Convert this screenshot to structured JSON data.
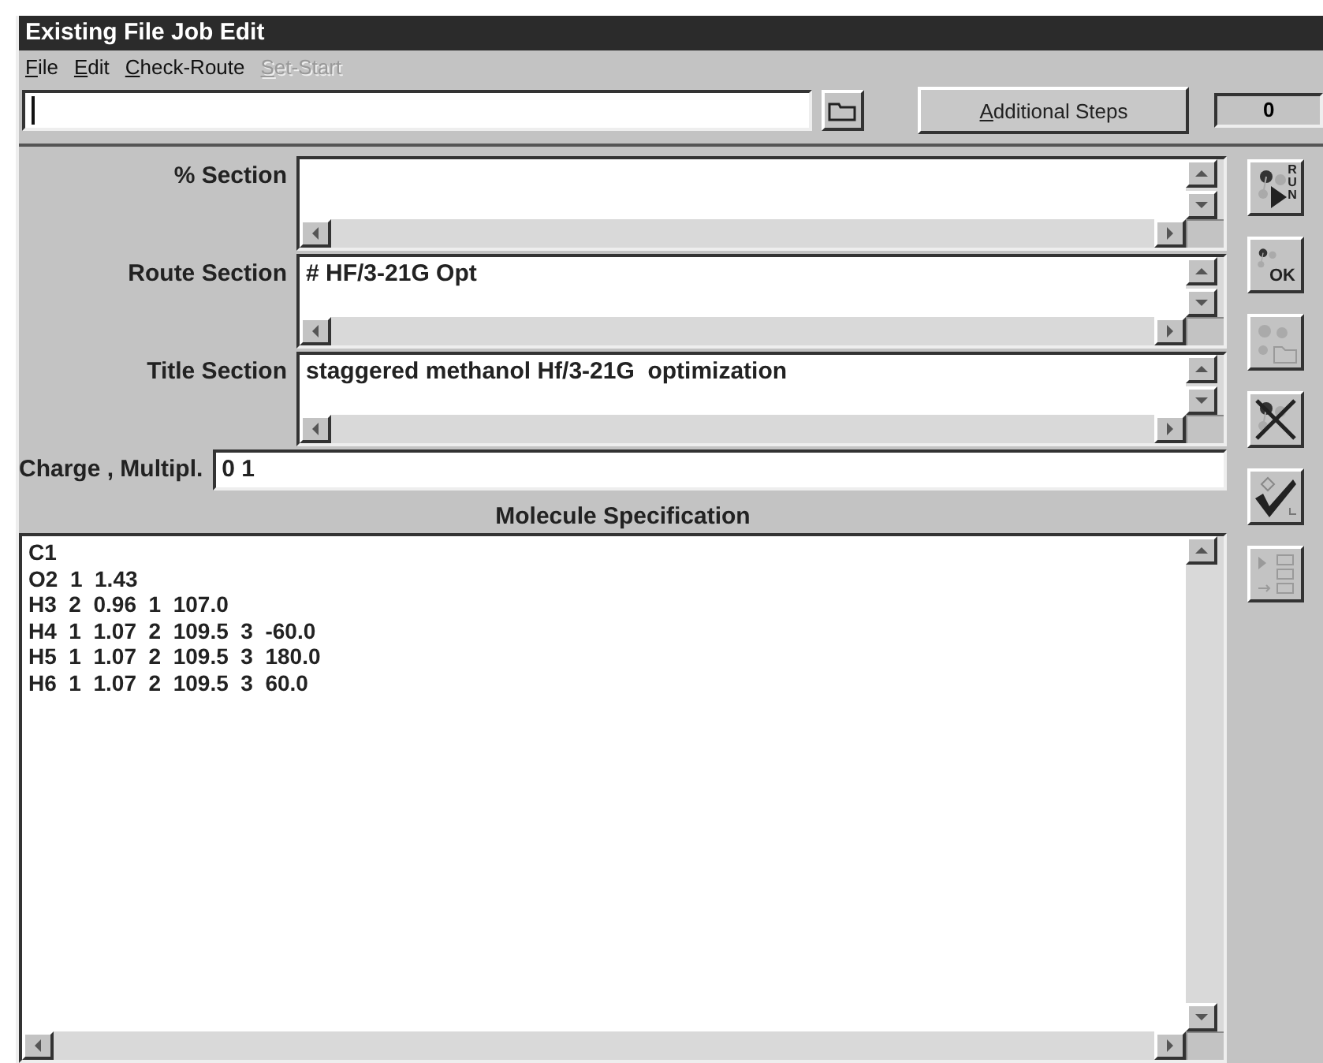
{
  "window": {
    "title": "Existing File Job Edit"
  },
  "menu": [
    {
      "label": "File",
      "disabled": false
    },
    {
      "label": "Edit",
      "disabled": false
    },
    {
      "label": "Check-Route",
      "disabled": false
    },
    {
      "label": "Set-Start",
      "disabled": true
    }
  ],
  "additional_steps_button": "Additional Steps",
  "steps_count": "0",
  "sections": [
    {
      "label": "% Section"
    },
    {
      "label": "Route Section",
      "value": "# HF/3-21G Opt"
    },
    {
      "label": "Title Section",
      "value": "staggered methanol Hf/3-21G  optimization"
    }
  ],
  "charge": {
    "label": "Charge , Multipl.",
    "value": "0 1"
  },
  "molecule": {
    "heading": "Molecule Specification",
    "lines": [
      "C1",
      "O2  1  1.43",
      "H3  2  0.96  1  107.0",
      "H4  1  1.07  2  109.5  3  -60.0",
      "H5  1  1.07  2  109.5  3  180.0",
      "H6  1  1.07  2  109.5  3  60.0"
    ]
  },
  "toolbar": [
    {
      "kind": "run",
      "label": "RUN",
      "disabled": false
    },
    {
      "kind": "ok",
      "label": "OK",
      "disabled": false
    },
    {
      "kind": "open",
      "disabled": true
    },
    {
      "kind": "cancel",
      "disabled": false
    },
    {
      "kind": "check",
      "disabled": false
    },
    {
      "kind": "list",
      "disabled": true
    }
  ]
}
